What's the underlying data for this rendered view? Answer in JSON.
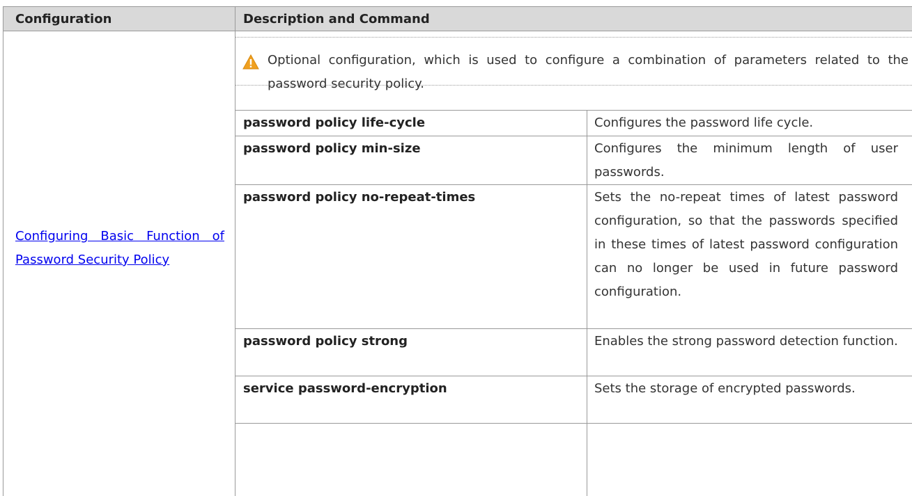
{
  "table": {
    "header": {
      "configuration": "Configuration",
      "description": "Description and Command"
    },
    "configuration_link": "Configuring Basic Function of Password Security Policy",
    "note": {
      "icon": "warning-icon",
      "text": "Optional configuration, which is used to configure a combination of parameters related to the password security policy."
    },
    "rows": [
      {
        "command": "password policy life-cycle",
        "description": "Configures the password life cycle."
      },
      {
        "command": "password policy min-size",
        "description": "Configures the minimum length of user passwords."
      },
      {
        "command": "password policy no-repeat-times",
        "description": "Sets the no-repeat times of latest password configuration, so that the passwords specified in these times of latest password configuration can no longer be used in future password configuration."
      },
      {
        "command": "password policy strong",
        "description": "Enables the strong password detection function."
      },
      {
        "command": "service password-encryption",
        "description": "Sets the storage of encrypted passwords."
      }
    ]
  },
  "colors": {
    "header_bg": "#d9d9d9",
    "border": "#999999",
    "link": "#0000ee",
    "warning": "#f0a020"
  }
}
